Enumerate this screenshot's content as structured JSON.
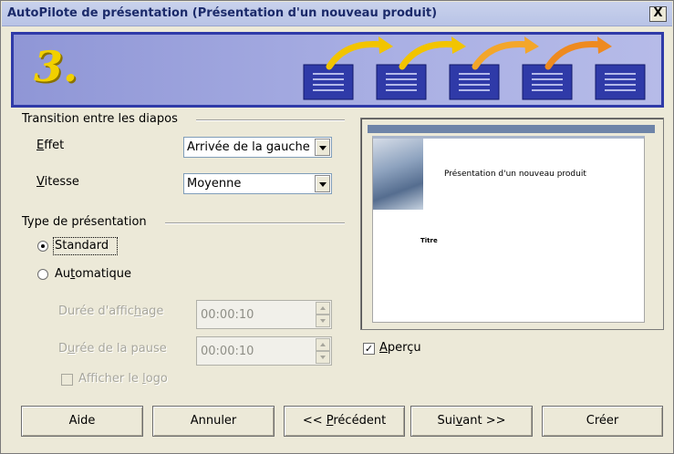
{
  "window": {
    "title": "AutoPilote de présentation (Présentation d'un nouveau produit)",
    "close_label": "X"
  },
  "banner": {
    "step_number": "3.",
    "step_count": 5
  },
  "transition_group": {
    "title": "Transition entre les diapos",
    "effect_label_accel": "E",
    "effect_label_rest": "ffet",
    "effect_value": "Arrivée de la gauche",
    "speed_label_accel": "V",
    "speed_label_rest": "itesse",
    "speed_value": "Moyenne"
  },
  "presentation_type_group": {
    "title": "Type de présentation",
    "standard_label": "Standard",
    "standard_selected": true,
    "automatic_label_before": "Au",
    "automatic_label_accel": "t",
    "automatic_label_after": "omatique",
    "automatic_selected": false,
    "display_duration_label_before": "Durée d'affic",
    "display_duration_label_accel": "h",
    "display_duration_label_after": "age",
    "display_duration_value": "00:00:10",
    "pause_duration_label_before": "D",
    "pause_duration_label_accel": "u",
    "pause_duration_label_after": "rée de la pause",
    "pause_duration_value": "00:00:10",
    "show_logo_label_before": "Afficher le ",
    "show_logo_label_accel": "l",
    "show_logo_label_after": "ogo"
  },
  "preview": {
    "slide_title": "Présentation d'un nouveau produit",
    "slide_subtitle": "Titre",
    "checkbox_label_accel": "A",
    "checkbox_label_rest": "perçu",
    "checked": true
  },
  "buttons": {
    "help": "Aide",
    "cancel": "Annuler",
    "previous_before": "<< ",
    "previous_accel": "P",
    "previous_after": "récédent",
    "next_before": "Sui",
    "next_accel": "v",
    "next_after": "ant >>",
    "create": "Créer"
  },
  "colors": {
    "banner_border": "#2f3aa8",
    "step_icon": "#2f3aa8",
    "arrow": "#f2c400"
  }
}
